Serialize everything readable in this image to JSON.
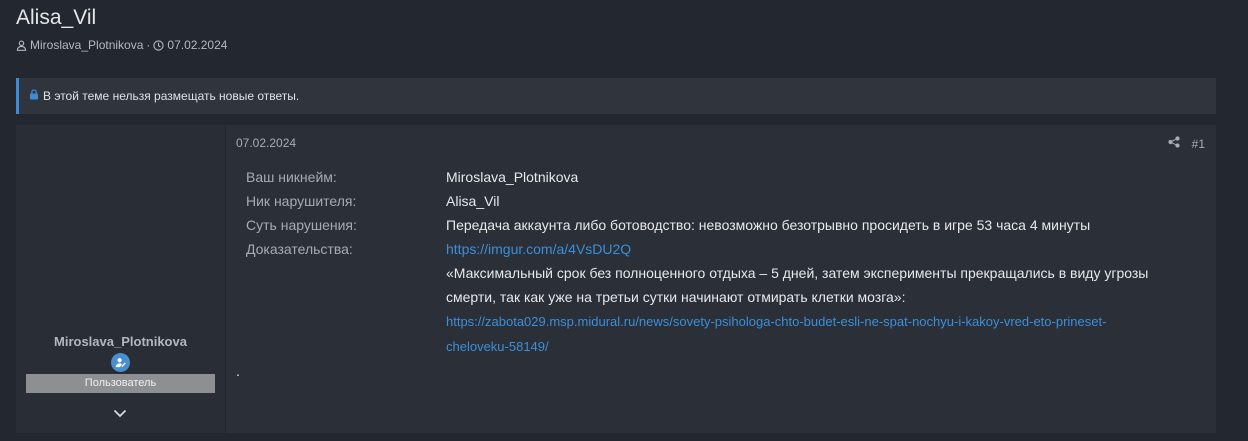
{
  "thread": {
    "title": "Alisa_Vil",
    "author": "Miroslava_Plotnikova",
    "separator": "·",
    "date": "07.02.2024"
  },
  "notice": {
    "text": "В этой теме нельзя размещать новые ответы."
  },
  "post": {
    "date": "07.02.2024",
    "number": "#1",
    "user": {
      "name": "Miroslava_Plotnikova",
      "role": "Пользователь"
    },
    "fields": [
      {
        "label": "Ваш никнейм:",
        "value": "Miroslava_Plotnikova"
      },
      {
        "label": "Ник нарушителя:",
        "value": "Alisa_Vil"
      },
      {
        "label": "Суть нарушения:",
        "value": "Передача аккаунта либо ботоводство: невозможно безотрывно просидеть в игре 53 часа 4 минуты"
      },
      {
        "label": "Доказательства:",
        "value": "https://imgur.com/a/4VsDU2Q"
      }
    ],
    "quote_line1": "«Максимальный срок без полноценного отдыха – 5 дней, затем эксперименты прекращались в виду угрозы",
    "quote_line2": "смерти, так как уже на третьи сутки начинают отмирать клетки мозга»:",
    "source_link_line1": "https://zabota029.msp.midural.ru/news/sovety-psihologa-chto-budet-esli-ne-spat-nochyu-i-kakoy-vred-eto-prineset-",
    "source_link_line2": "cheloveku-58149/",
    "trailing": "."
  },
  "colors": {
    "background": "#23272f",
    "panel": "#2b2f37",
    "accent": "#3d8bd4",
    "link": "#3b8fd9",
    "role_badge": "#8d8f92"
  }
}
